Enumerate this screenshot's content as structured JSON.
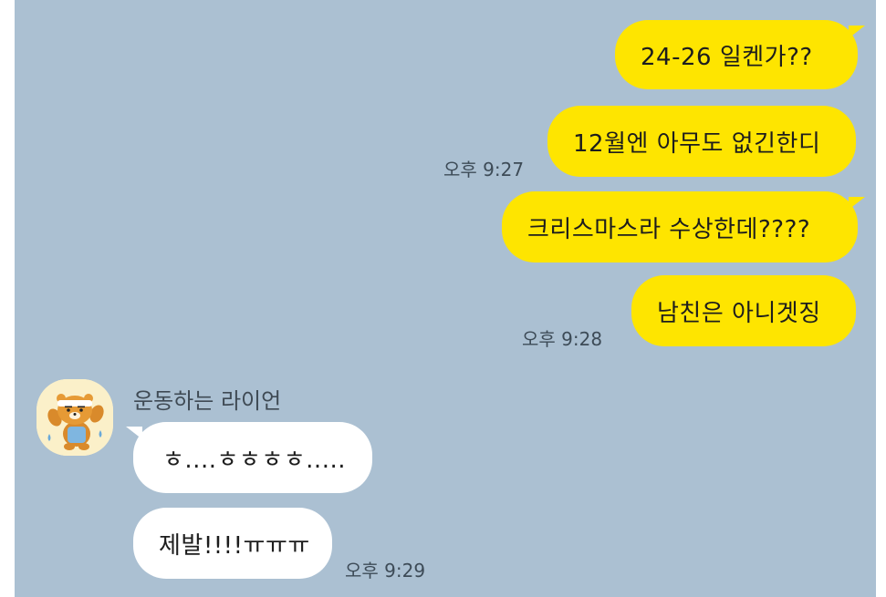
{
  "colors": {
    "background": "#abc0d2",
    "my_bubble": "#fee500",
    "their_bubble": "#ffffff",
    "time_text": "#3d4b57"
  },
  "messages_sent": [
    {
      "text": "24-26 일켄가??",
      "time": ""
    },
    {
      "text": "12월엔 아무도 없긴한디",
      "time": "오후 9:27"
    },
    {
      "text": "크리스마스라 수상한데????",
      "time": ""
    },
    {
      "text": "남친은 아니겟징",
      "time": "오후 9:28"
    }
  ],
  "contact": {
    "name": "운동하는 라이언",
    "avatar_icon": "ryan-exercising-icon"
  },
  "messages_received": [
    {
      "text": "ㅎ....ㅎㅎㅎㅎ.....",
      "time": ""
    },
    {
      "text": "제발!!!!ㅠㅠㅠ",
      "time": "오후 9:29"
    }
  ]
}
